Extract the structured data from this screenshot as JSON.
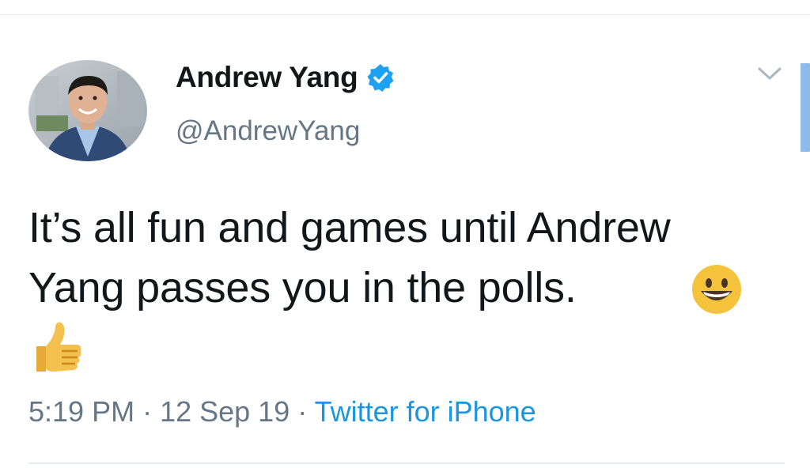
{
  "tweet": {
    "author": {
      "display_name": "Andrew Yang",
      "handle": "@AndrewYang",
      "verified": true,
      "avatar_icon": "profile-photo"
    },
    "text_line_1": "It’s all fun and games until Andrew",
    "text_line_2": "Yang passes you in the polls.",
    "emojis": [
      "grinning-face-emoji",
      "thumbs-up-emoji"
    ],
    "meta": {
      "time": "5:19 PM",
      "separator_1": " · ",
      "date": "12 Sep 19",
      "separator_2": " · ",
      "source": "Twitter for iPhone"
    },
    "menu_icon": "chevron-down-icon"
  },
  "colors": {
    "text_primary": "#14171a",
    "text_secondary": "#657786",
    "link": "#1b95e0",
    "verified_badge": "#1da1f2",
    "divider": "#e6ecf0"
  }
}
